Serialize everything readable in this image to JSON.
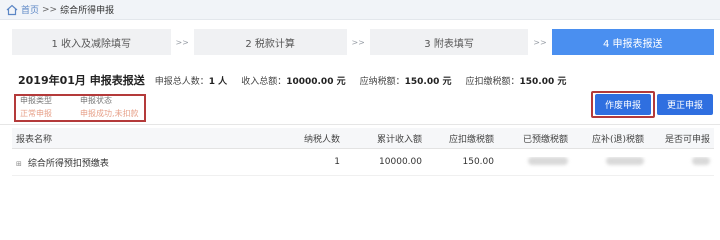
{
  "breadcrumb": {
    "home": "首页",
    "separator": ">>",
    "current": "综合所得申报"
  },
  "steps": [
    {
      "label": "1 收入及减除填写",
      "active": false
    },
    {
      "label": "2 税款计算",
      "active": false
    },
    {
      "label": "3 附表填写",
      "active": false
    },
    {
      "label": "4 申报表报送",
      "active": true
    }
  ],
  "step_arrow": ">>",
  "summary": {
    "title": "2019年01月  申报表报送",
    "people_label": "申报总人数：",
    "people_value": "1 人",
    "income_label": "收入总额：",
    "income_value": "10000.00 元",
    "payable_label": "应纳税额：",
    "payable_value": "150.00 元",
    "withhold_label": "应扣缴税额：",
    "withhold_value": "150.00 元"
  },
  "declare": {
    "type_label": "申报类型",
    "status_label": "申报状态",
    "type_value": "正常申报",
    "status_value": "申报成功,未扣款"
  },
  "buttons": {
    "submit": "作废申报",
    "correct": "更正申报"
  },
  "table": {
    "headers": [
      "报表名称",
      "纳税人数",
      "累计收入额",
      "应扣缴税额",
      "已预缴税额",
      "应补(退)税额",
      "是否可申报"
    ],
    "rows": [
      {
        "name": "综合所得预扣预缴表",
        "people": "1",
        "income": "10000.00",
        "payable": "150.00"
      }
    ]
  },
  "colors": {
    "accent": "#4a8ff0",
    "button": "#2f6fe0",
    "highlight": "#b43a3a"
  }
}
